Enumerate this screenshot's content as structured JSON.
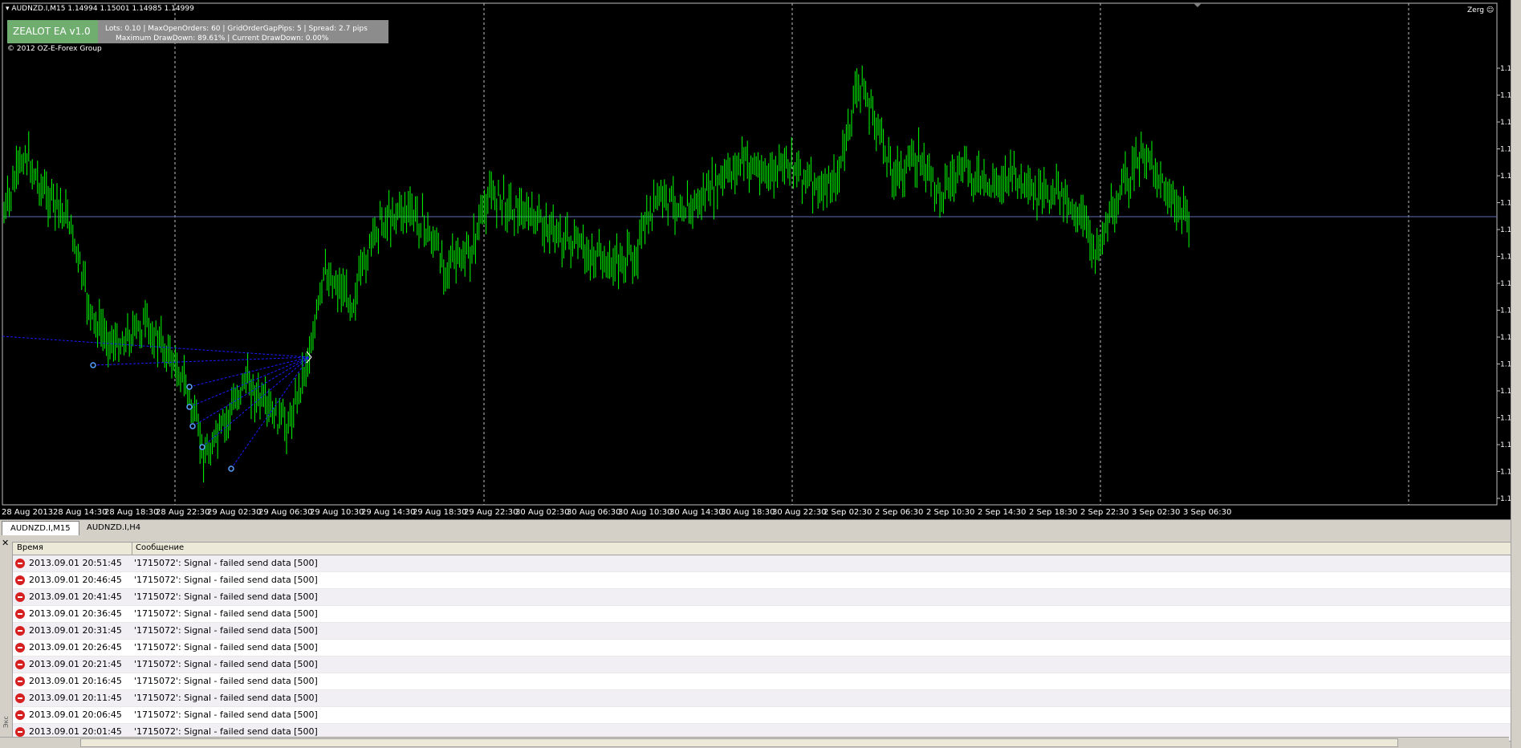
{
  "chart": {
    "symbol_header": "AUDNZD.I,M15  1.14994 1.15001 1.14985 1.14999",
    "copyright": "© 2012 OZ-E-Forex Group",
    "ea_title": "ZEALOT EA v1.0",
    "ea_line1": "Lots: 0.10   |   MaxOpenOrders: 60   |   GridOrderGapPips: 5   |   Spread: 2.7 pips",
    "ea_line2": "Maximum DrawDown: 89.61%   |        Current DrawDown: 0.00%",
    "expert_name": "Zerg ☺",
    "time_labels": [
      "28 Aug 2013",
      "28 Aug 14:30",
      "28 Aug 18:30",
      "28 Aug 22:30",
      "29 Aug 02:30",
      "29 Aug 06:30",
      "29 Aug 10:30",
      "29 Aug 14:30",
      "29 Aug 18:30",
      "29 Aug 22:30",
      "30 Aug 02:30",
      "30 Aug 06:30",
      "30 Aug 10:30",
      "30 Aug 14:30",
      "30 Aug 18:30",
      "30 Aug 22:30",
      "2 Sep 02:30",
      "2 Sep 06:30",
      "2 Sep 10:30",
      "2 Sep 14:30",
      "2 Sep 18:30",
      "2 Sep 22:30",
      "3 Sep 02:30",
      "3 Sep 06:30"
    ],
    "price_labels": [
      "1.1",
      "1.1",
      "1.1",
      "1.1",
      "1.1",
      "1.1",
      "1.1",
      "1.1",
      "1.1",
      "1.1",
      "1.1",
      "1.1",
      "1.1",
      "1.1",
      "1.1",
      "1.1",
      "1.1",
      "1.1",
      "1.1"
    ],
    "colors": {
      "bull": "#00ff00",
      "bear": "#00ff00",
      "grid": "#c0c0c0",
      "orders": "#1a1aff",
      "bid": "#5f6fb0"
    }
  },
  "tabs": [
    {
      "label": "AUDNZD.I,M15",
      "active": true
    },
    {
      "label": "AUDNZD.I,H4",
      "active": false
    }
  ],
  "log": {
    "col_time": "Время",
    "col_message": "Сообщение",
    "side_label": "Экс",
    "rows": [
      {
        "time": "2013.09.01 20:51:45",
        "message": "'1715072': Signal - failed send data [500]"
      },
      {
        "time": "2013.09.01 20:46:45",
        "message": "'1715072': Signal - failed send data [500]"
      },
      {
        "time": "2013.09.01 20:41:45",
        "message": "'1715072': Signal - failed send data [500]"
      },
      {
        "time": "2013.09.01 20:36:45",
        "message": "'1715072': Signal - failed send data [500]"
      },
      {
        "time": "2013.09.01 20:31:45",
        "message": "'1715072': Signal - failed send data [500]"
      },
      {
        "time": "2013.09.01 20:26:45",
        "message": "'1715072': Signal - failed send data [500]"
      },
      {
        "time": "2013.09.01 20:21:45",
        "message": "'1715072': Signal - failed send data [500]"
      },
      {
        "time": "2013.09.01 20:16:45",
        "message": "'1715072': Signal - failed send data [500]"
      },
      {
        "time": "2013.09.01 20:11:45",
        "message": "'1715072': Signal - failed send data [500]"
      },
      {
        "time": "2013.09.01 20:06:45",
        "message": "'1715072': Signal - failed send data [500]"
      },
      {
        "time": "2013.09.01 20:01:45",
        "message": "'1715072': Signal - failed send data [500]"
      }
    ]
  }
}
